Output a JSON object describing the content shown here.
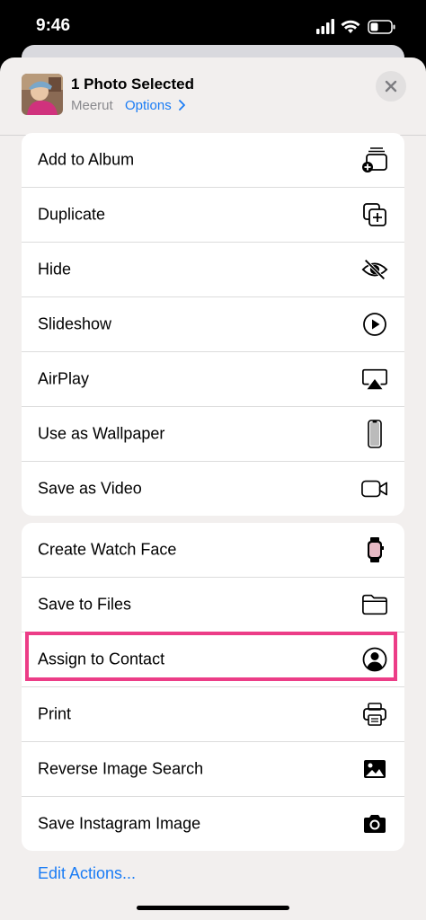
{
  "status": {
    "time": "9:46"
  },
  "header": {
    "title": "1 Photo Selected",
    "location": "Meerut",
    "options_label": "Options"
  },
  "group1": [
    {
      "label": "Add to Album",
      "icon": "add-to-album-icon"
    },
    {
      "label": "Duplicate",
      "icon": "duplicate-icon"
    },
    {
      "label": "Hide",
      "icon": "hide-eye-icon"
    },
    {
      "label": "Slideshow",
      "icon": "play-circle-icon"
    },
    {
      "label": "AirPlay",
      "icon": "airplay-icon"
    },
    {
      "label": "Use as Wallpaper",
      "icon": "phone-icon"
    },
    {
      "label": "Save as Video",
      "icon": "video-camera-icon"
    }
  ],
  "group2": [
    {
      "label": "Create Watch Face",
      "icon": "watch-icon"
    },
    {
      "label": "Save to Files",
      "icon": "folder-icon"
    },
    {
      "label": "Assign to Contact",
      "icon": "contact-icon"
    },
    {
      "label": "Print",
      "icon": "printer-icon"
    },
    {
      "label": "Reverse Image Search",
      "icon": "image-icon"
    },
    {
      "label": "Save Instagram Image",
      "icon": "camera-icon"
    }
  ],
  "footer": {
    "edit_actions_label": "Edit Actions..."
  },
  "colors": {
    "accent": "#1a7cf5",
    "highlight": "#ec3d87"
  }
}
